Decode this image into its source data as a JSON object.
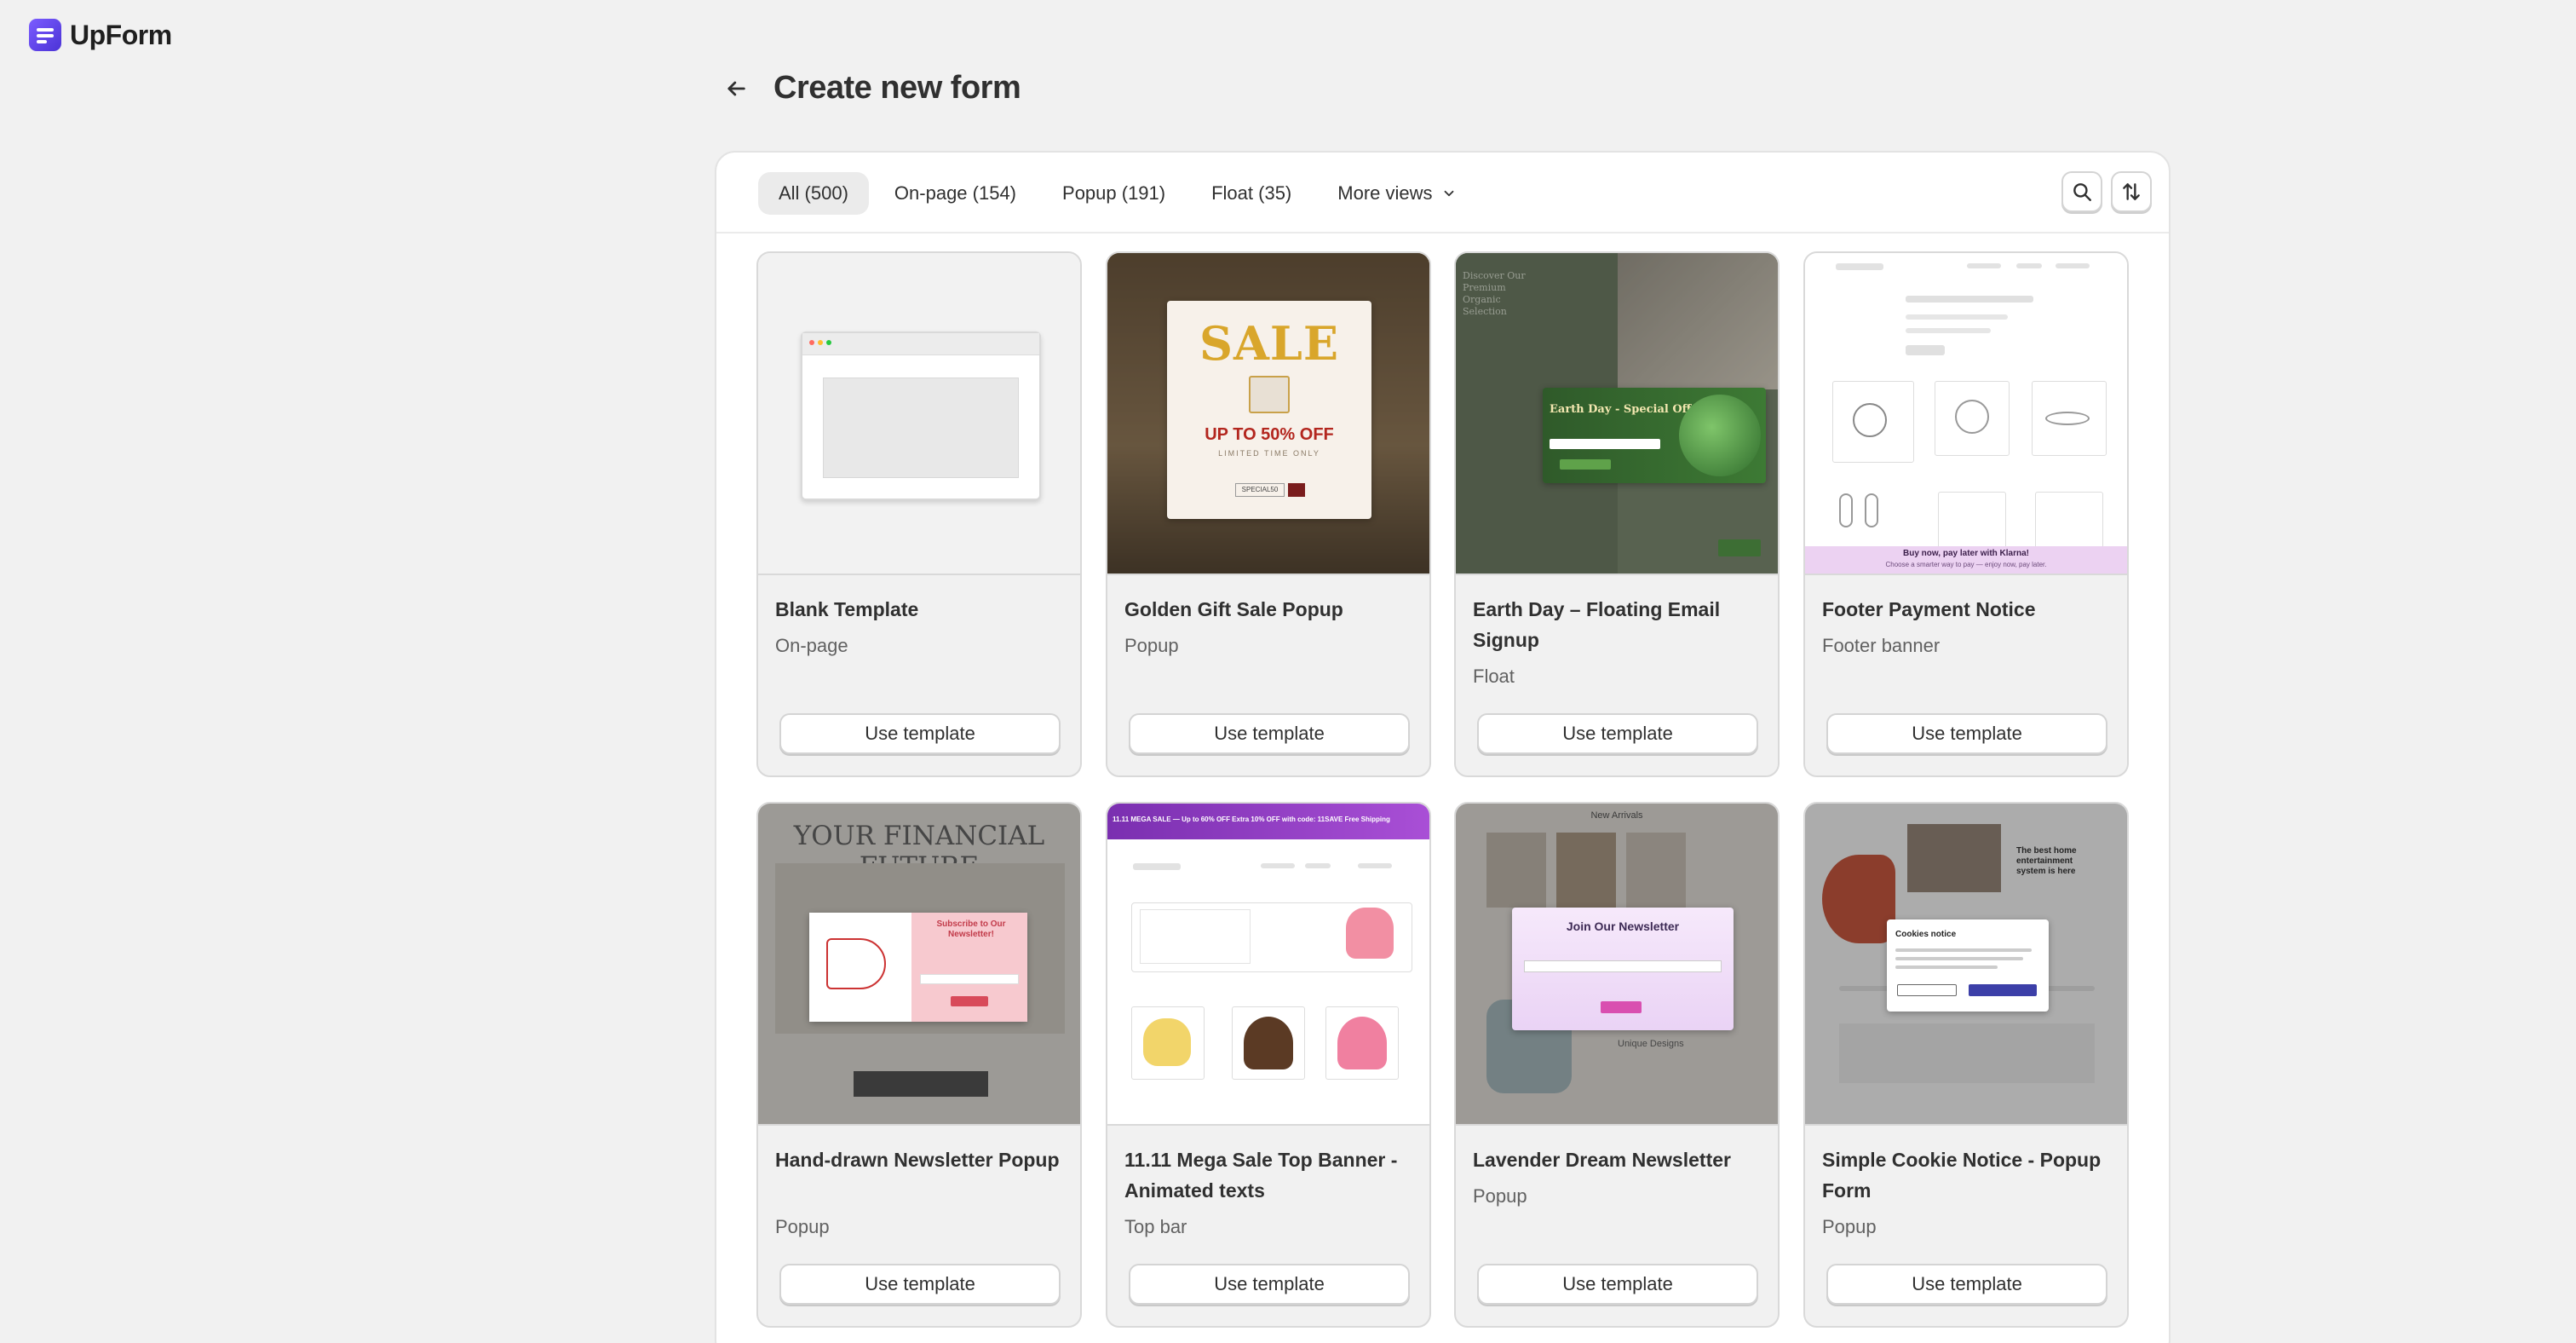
{
  "app": {
    "name": "UpForm"
  },
  "page": {
    "title": "Create new form"
  },
  "tabs": [
    {
      "label": "All (500)",
      "active": true
    },
    {
      "label": "On-page (154)",
      "active": false
    },
    {
      "label": "Popup (191)",
      "active": false
    },
    {
      "label": "Float (35)",
      "active": false
    },
    {
      "label": "More views",
      "active": false
    }
  ],
  "toolbar": {
    "search_icon": "search-icon",
    "sort_icon": "sort-icon"
  },
  "use_label": "Use template",
  "templates": [
    {
      "name": "Blank Template",
      "type": "On-page"
    },
    {
      "name": "Golden Gift Sale Popup",
      "type": "Popup",
      "thumb": {
        "headline": "SALE",
        "offer": "UP TO 50% OFF",
        "sub": "LIMITED TIME ONLY",
        "code": "SPECIAL50"
      }
    },
    {
      "name": "Earth Day – Floating Email Signup",
      "type": "Float",
      "thumb": {
        "headline": "Earth Day - Special Offer",
        "bg_text": "Discover Our Premium Organic Selection"
      }
    },
    {
      "name": "Footer Payment Notice",
      "type": "Footer banner",
      "thumb": {
        "banner": "Buy now, pay later with Klarna!",
        "banner_sub": "Choose a smarter way to pay — enjoy now, pay later."
      }
    },
    {
      "name": "Hand-drawn Newsletter Popup",
      "type": "Popup",
      "thumb": {
        "bg_text": "YOUR FINANCIAL FUTURE",
        "headline": "Subscribe to Our Newsletter!"
      }
    },
    {
      "name": "11.11 Mega Sale Top Banner - Animated texts",
      "type": "Top bar",
      "thumb": {
        "banner": "11.11 MEGA SALE — Up to 60% OFF  Extra 10% OFF with code: 11SAVE  Free Shipping"
      }
    },
    {
      "name": "Lavender Dream Newsletter",
      "type": "Popup",
      "thumb": {
        "headline": "Join Our Newsletter",
        "bg_top": "New Arrivals",
        "bg_bottom": "Unique Designs"
      }
    },
    {
      "name": "Simple Cookie Notice - Popup Form",
      "type": "Popup",
      "thumb": {
        "headline": "Cookies notice",
        "bg_text": "The best home entertainment system is here"
      }
    }
  ],
  "colors": {
    "brand": "#5b3ff0",
    "page_bg": "#f1f1f1",
    "active_tab": "#ebebeb"
  }
}
